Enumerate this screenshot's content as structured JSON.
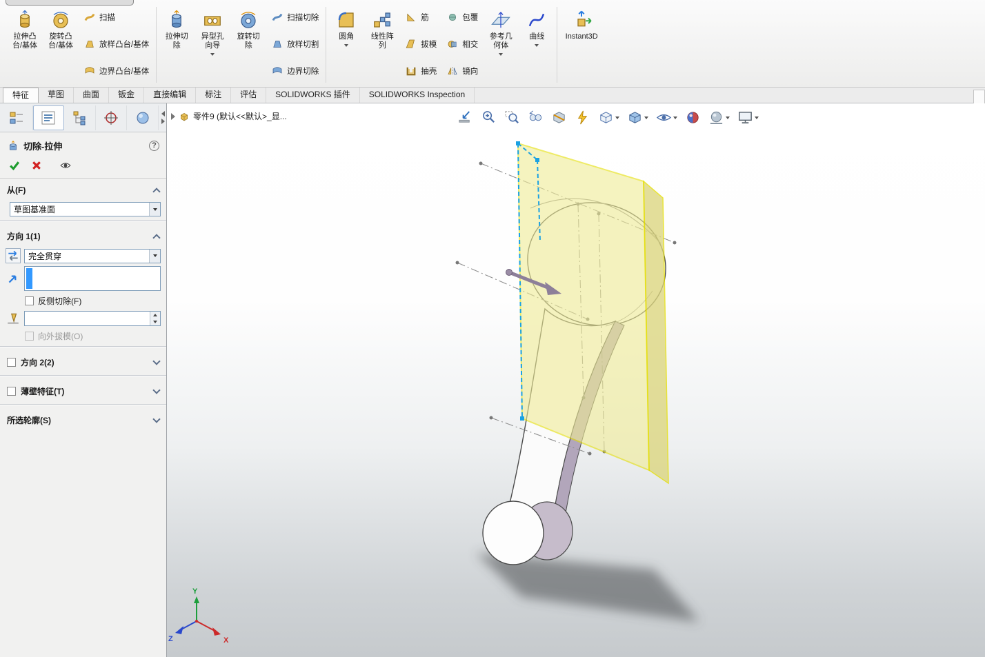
{
  "colors": {
    "preview_yellow": "#f0ec96",
    "preview_yellow_edge": "#e4de00",
    "sketch_blue": "#1ba1e2",
    "selection_blue": "#3399ff",
    "ok_green": "#1f9d2f",
    "cancel_red": "#d22222",
    "triad_x_red": "#cc2a2a",
    "triad_y_green": "#1c9e3c",
    "triad_z_blue": "#2a48cc"
  },
  "ribbon": {
    "groups": [
      {
        "items": [
          {
            "label": "拉伸凸\n台/基体"
          },
          {
            "label": "旋转凸\n台/基体"
          }
        ]
      },
      {
        "items": [
          {
            "label": "扫描"
          },
          {
            "label": "放样凸台/基体"
          },
          {
            "label": "边界凸台/基体"
          }
        ]
      },
      {
        "items": [
          {
            "label": "拉伸切\n除"
          },
          {
            "label": "异型孔\n向导"
          },
          {
            "label": "旋转切\n除"
          }
        ]
      },
      {
        "items": [
          {
            "label": "扫描切除"
          },
          {
            "label": "放样切割"
          },
          {
            "label": "边界切除"
          }
        ]
      },
      {
        "items": [
          {
            "label": "圆角"
          },
          {
            "label": "线性阵\n列"
          }
        ]
      },
      {
        "items": [
          {
            "label": "筋"
          },
          {
            "label": "拔模"
          },
          {
            "label": "抽壳"
          }
        ]
      },
      {
        "items": [
          {
            "label": "包覆"
          },
          {
            "label": "相交"
          },
          {
            "label": "镜向"
          }
        ]
      },
      {
        "items": [
          {
            "label": "参考几\n何体"
          },
          {
            "label": "曲线"
          }
        ]
      },
      {
        "items": [
          {
            "label": "Instant3D"
          }
        ]
      }
    ]
  },
  "tabs": [
    {
      "label": "特征"
    },
    {
      "label": "草图"
    },
    {
      "label": "曲面"
    },
    {
      "label": "钣金"
    },
    {
      "label": "直接编辑"
    },
    {
      "label": "标注"
    },
    {
      "label": "评估"
    },
    {
      "label": "SOLIDWORKS 插件"
    },
    {
      "label": "SOLIDWORKS Inspection"
    }
  ],
  "property_manager": {
    "tab_icons": [
      "feature-manager-tree",
      "property-manager",
      "configuration-manager",
      "dimxpert-manager",
      "display-manager"
    ],
    "title": "切除-拉伸",
    "help": "?",
    "from_section": {
      "label": "从(F)",
      "value": "草图基准面"
    },
    "direction1": {
      "label": "方向 1(1)",
      "end_condition": "完全贯穿",
      "direction_value": "",
      "flip_side_label": "反侧切除(F)",
      "draft_value": "",
      "draft_outward_label": "向外拔模(O)"
    },
    "direction2": {
      "label": "方向 2(2)"
    },
    "thin_feature": {
      "label": "薄壁特征(T)"
    },
    "selected_contours": {
      "label": "所选轮廓(S)"
    }
  },
  "viewport": {
    "breadcrumb": "零件9 (默认<<默认>_显...",
    "hud_icons": [
      "zoom-to-fit",
      "zoom-in-out",
      "zoom-to-area",
      "previous-view",
      "section-view",
      "lightning-annotation",
      "view-orientation",
      "display-style",
      "hide-show-items",
      "edit-appearance",
      "apply-scene",
      "view-settings"
    ],
    "triad": {
      "x": "X",
      "y": "Y",
      "z": "Z"
    }
  }
}
